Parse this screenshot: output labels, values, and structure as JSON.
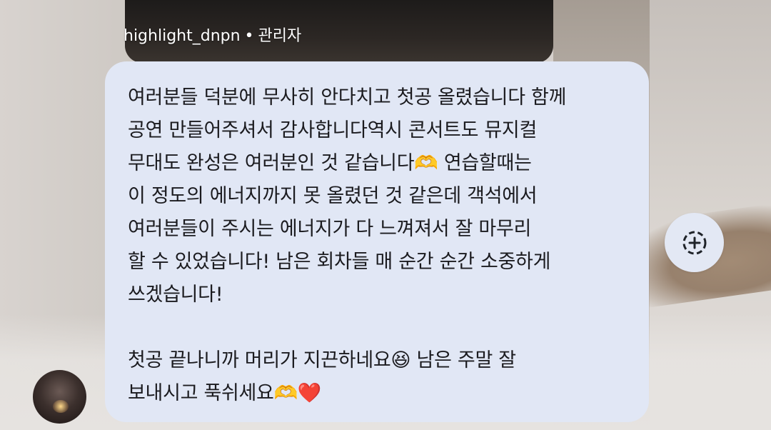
{
  "message": {
    "author": "highlight_dnpn",
    "separator": "•",
    "role": "관리자",
    "text": "여러분들 덕분에 무사히 안다치고 첫공 올렸습니다 함께\n공연 만들어주셔서 감사합니다역시 콘서트도 뮤지컬\n무대도 완성은 여러분인 것 같습니다🫶 연습할때는\n이 정도의 에너지까지 못 올렸던 것 같은데 객석에서\n여러분들이 주시는 에너지가 다 느껴져서 잘 마무리\n할 수 있었습니다! 남은 회차들 매 순간 순간 소중하게\n쓰겠습니다!\n\n첫공 끝나니까 머리가 지끈하네요😆 남은 주말 잘\n보내시고 푹쉬세요🫶❤️"
  },
  "icons": {
    "avatar": "profile-avatar",
    "reaction": "add-reaction-icon"
  },
  "colors": {
    "bubble": "#e1e7f5",
    "text": "#1b1b1f",
    "reaction_button": "#e3e8f4"
  }
}
